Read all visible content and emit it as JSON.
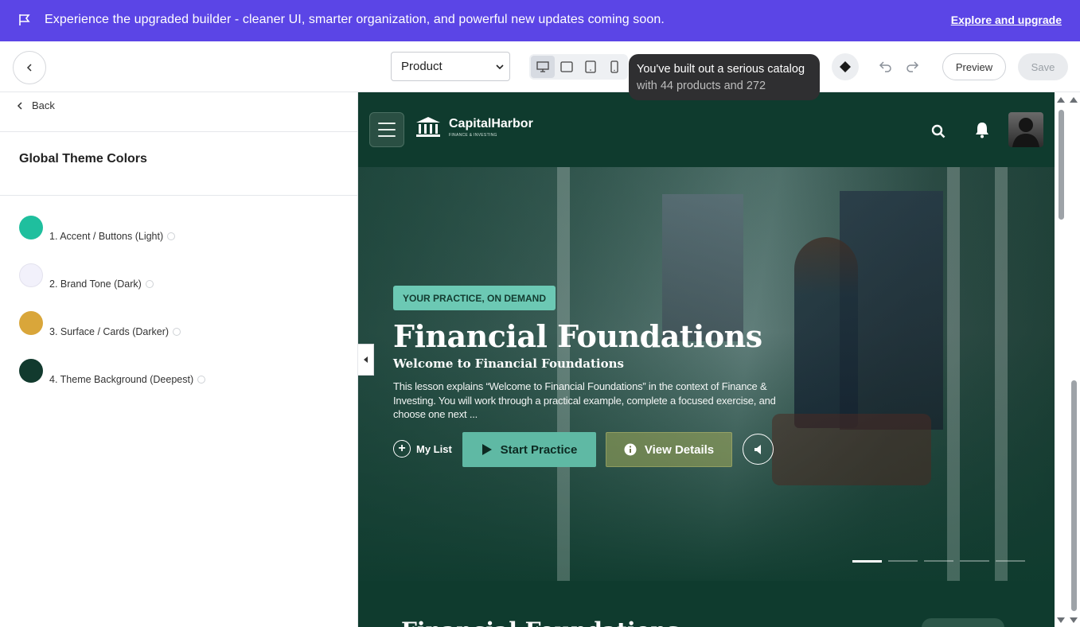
{
  "banner": {
    "icon": "flag-icon",
    "message": "Experience the upgraded builder - cleaner UI, smarter organization, and powerful new updates coming soon.",
    "link": "Explore and upgrade",
    "color": "#5b45e6"
  },
  "toolbar": {
    "page_select": "Product",
    "devices": [
      "desktop-icon",
      "tablet-landscape-icon",
      "tablet-portrait-icon",
      "mobile-icon"
    ],
    "tooltip_line1": "You've built out a serious catalog",
    "tooltip_line2": "with 44 products and 272",
    "preview_label": "Preview",
    "save_label": "Save"
  },
  "left_panel": {
    "back_label": "Back",
    "title": "Global Theme Colors",
    "colors": [
      {
        "label": "1. Accent / Buttons (Light)",
        "hex": "#1fbf9e"
      },
      {
        "label": "2. Brand Tone (Dark)",
        "hex": "#f2f1fb"
      },
      {
        "label": "3. Surface / Cards (Darker)",
        "hex": "#d9a63a"
      },
      {
        "label": "4. Theme Background (Deepest)",
        "hex": "#123a2e"
      }
    ]
  },
  "site": {
    "brand_name": "CapitalHarbor",
    "brand_tagline": "FINANCE & INVESTING",
    "hero": {
      "badge": "YOUR PRACTICE, ON DEMAND",
      "title": "Financial Foundations",
      "subtitle": "Welcome to Financial Foundations",
      "description": "This lesson explains “Welcome to Financial Foundations” in the context of Finance & Investing. You will work through a practical example, complete a focused exercise, and choose one next ...",
      "my_list": "My List",
      "start_practice": "Start Practice",
      "view_details": "View Details",
      "slides": 5,
      "active_slide": 1
    },
    "next_section_title": "Financial Foundations"
  }
}
